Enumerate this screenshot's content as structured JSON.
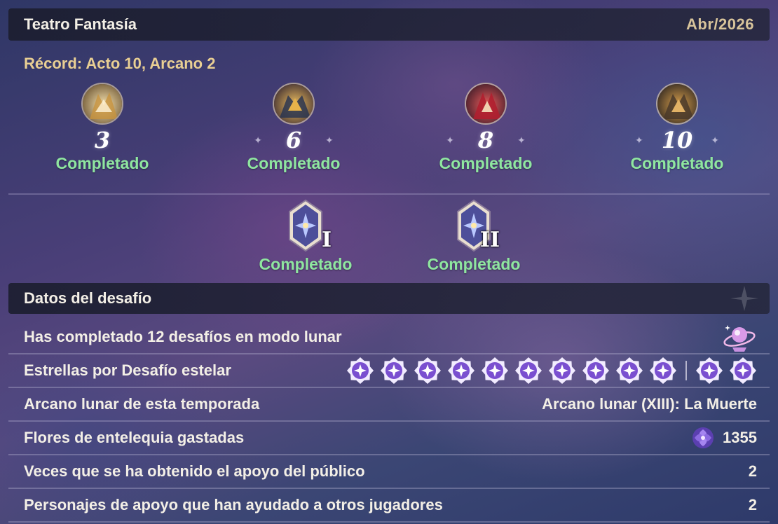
{
  "header": {
    "title": "Teatro Fantasía",
    "date": "Abr/2026"
  },
  "record": "Récord: Acto 10, Arcano 2",
  "acts": [
    {
      "number": "3",
      "status": "Completado",
      "icon": "character-avatar-icon"
    },
    {
      "number": "6",
      "status": "Completado",
      "icon": "character-avatar-icon"
    },
    {
      "number": "8",
      "status": "Completado",
      "icon": "character-avatar-icon"
    },
    {
      "number": "10",
      "status": "Completado",
      "icon": "character-avatar-icon"
    }
  ],
  "arcana": [
    {
      "numeral": "I",
      "status": "Completado",
      "icon": "arcanum-card-icon"
    },
    {
      "numeral": "II",
      "status": "Completado",
      "icon": "arcanum-card-icon"
    }
  ],
  "section": {
    "title": "Datos del desafío"
  },
  "stats": {
    "lunar_mode": {
      "label": "Has completado 12 desafíos en modo lunar",
      "icon": "lunar-emblem-icon"
    },
    "stars": {
      "label": "Estrellas por Desafío estelar",
      "count_before_separator": 10,
      "count_after_separator": 2,
      "icon": "star-medal-icon"
    },
    "arcanum": {
      "label": "Arcano lunar de esta temporada",
      "value": "Arcano lunar (XIII): La Muerte"
    },
    "flowers": {
      "label": "Flores de entelequia gastadas",
      "value": "1355",
      "icon": "flower-icon"
    },
    "audience": {
      "label": "Veces que se ha obtenido el apoyo del público",
      "value": "2"
    },
    "support": {
      "label": "Personajes de apoyo que han ayudado a otros jugadores",
      "value": "2"
    }
  },
  "colors": {
    "completed": "#8fe6a0",
    "record": "#e9cf93",
    "date": "#d8c49b",
    "star_badge": "#7a4fd0"
  }
}
